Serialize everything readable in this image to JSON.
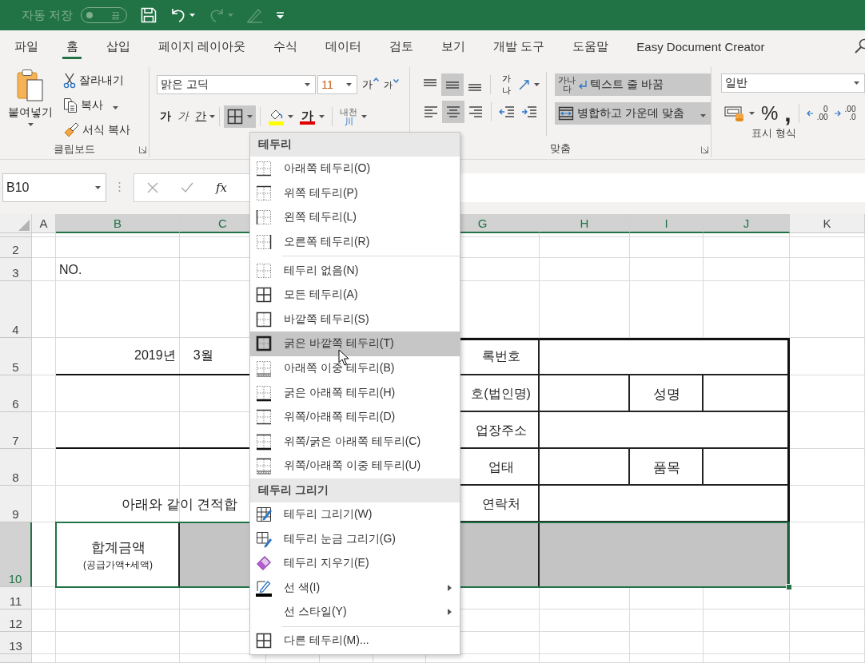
{
  "titlebar": {
    "autosave": "자동 저장",
    "autosave_state": "끔",
    "autosave_on": false
  },
  "tabs": [
    {
      "label": "파일",
      "selected": false
    },
    {
      "label": "홈",
      "selected": true
    },
    {
      "label": "삽입",
      "selected": false
    },
    {
      "label": "페이지 레이아웃",
      "selected": false
    },
    {
      "label": "수식",
      "selected": false
    },
    {
      "label": "데이터",
      "selected": false
    },
    {
      "label": "검토",
      "selected": false
    },
    {
      "label": "보기",
      "selected": false
    },
    {
      "label": "개발 도구",
      "selected": false
    },
    {
      "label": "도움말",
      "selected": false
    },
    {
      "label": "Easy Document Creator",
      "selected": false
    }
  ],
  "clipboard": {
    "paste": "붙여넣기",
    "cut": "잘라내기",
    "copy": "복사",
    "format_painter": "서식 복사",
    "label": "클립보드"
  },
  "font": {
    "name": "맑은 고딕",
    "size": "11",
    "grow": "가",
    "shrink": "가",
    "bold": "가",
    "italic": "가",
    "underline": "간",
    "borders_pressed": true,
    "font_color": "가",
    "phonetic": "내천",
    "phonetic_sub": "川"
  },
  "alignment": {
    "vertical": [
      {
        "selected": false
      },
      {
        "selected": true
      },
      {
        "selected": false
      }
    ],
    "horizontal": [
      {
        "selected": false
      },
      {
        "selected": true
      },
      {
        "selected": false
      }
    ],
    "orientation_icon": "가나",
    "wrap_icon": [
      "가나",
      "다"
    ],
    "wrap_text": "텍스트 줄 바꿈",
    "wrap_selected": true,
    "merge": "병합하고 가운데 맞춤",
    "merge_selected": true,
    "label": "맞춤"
  },
  "number": {
    "format": "일반",
    "percent": "%",
    "comma": ",",
    "decimal_increase": [
      "0",
      ".00"
    ],
    "decimal_decrease": [
      ".00",
      ".0"
    ],
    "label": "표시 형식"
  },
  "formula_bar": {
    "name_box": "B10",
    "fx": "fx"
  },
  "sheet": {
    "columns": [
      {
        "label": "A",
        "selected": false
      },
      {
        "label": "B",
        "selected": true
      },
      {
        "label": "C",
        "selected": true
      },
      {
        "label": "G",
        "selected": true
      },
      {
        "label": "H",
        "selected": true
      },
      {
        "label": "I",
        "selected": true
      },
      {
        "label": "J",
        "selected": true
      },
      {
        "label": "K",
        "selected": false
      }
    ],
    "rows": [
      {
        "label": "2",
        "selected": false
      },
      {
        "label": "3",
        "selected": false
      },
      {
        "label": "4",
        "selected": false
      },
      {
        "label": "5",
        "selected": false
      },
      {
        "label": "6",
        "selected": false
      },
      {
        "label": "7",
        "selected": false
      },
      {
        "label": "8",
        "selected": false
      },
      {
        "label": "9",
        "selected": false
      },
      {
        "label": "10",
        "selected": true
      },
      {
        "label": "11",
        "selected": false
      },
      {
        "label": "12",
        "selected": false
      },
      {
        "label": "13",
        "selected": false
      }
    ],
    "cells": [
      {
        "text": "NO."
      },
      {
        "text": "2019년     3월"
      },
      {
        "text": "아래와 같이 견적합"
      },
      {
        "text": "합계금액",
        "note": "(공급가액+세액)"
      },
      {
        "text": "록번호"
      },
      {
        "text": "호(법인명)"
      },
      {
        "text": "성명"
      },
      {
        "text": "업장주소"
      },
      {
        "text": "업태"
      },
      {
        "text": "품목"
      },
      {
        "text": "연락처"
      }
    ]
  },
  "menu": {
    "items": [
      {
        "kind": "header",
        "label": "테두리"
      },
      {
        "kind": "item",
        "label": "아래쪽 테두리(O)",
        "selected": false,
        "submenu": false
      },
      {
        "kind": "item",
        "label": "위쪽 테두리(P)",
        "selected": false,
        "submenu": false
      },
      {
        "kind": "item",
        "label": "왼쪽 테두리(L)",
        "selected": false,
        "submenu": false
      },
      {
        "kind": "item",
        "label": "오른쪽 테두리(R)",
        "selected": false,
        "submenu": false
      },
      {
        "kind": "separator"
      },
      {
        "kind": "item",
        "label": "테두리 없음(N)",
        "selected": false,
        "submenu": false
      },
      {
        "kind": "item",
        "label": "모든 테두리(A)",
        "selected": false,
        "submenu": false
      },
      {
        "kind": "item",
        "label": "바깥쪽 테두리(S)",
        "selected": false,
        "submenu": false
      },
      {
        "kind": "item",
        "label": "굵은 바깥쪽 테두리(T)",
        "selected": true,
        "submenu": false
      },
      {
        "kind": "item",
        "label": "아래쪽 이중 테두리(B)",
        "selected": false,
        "submenu": false
      },
      {
        "kind": "item",
        "label": "굵은 아래쪽 테두리(H)",
        "selected": false,
        "submenu": false
      },
      {
        "kind": "item",
        "label": "위쪽/아래쪽 테두리(D)",
        "selected": false,
        "submenu": false
      },
      {
        "kind": "item",
        "label": "위쪽/굵은 아래쪽 테두리(C)",
        "selected": false,
        "submenu": false
      },
      {
        "kind": "item",
        "label": "위쪽/아래쪽 이중 테두리(U)",
        "selected": false,
        "submenu": false
      },
      {
        "kind": "header",
        "label": "테두리 그리기"
      },
      {
        "kind": "item",
        "label": "테두리 그리기(W)",
        "selected": false,
        "submenu": false
      },
      {
        "kind": "item",
        "label": "테두리 눈금 그리기(G)",
        "selected": false,
        "submenu": false
      },
      {
        "kind": "item",
        "label": "테두리 지우기(E)",
        "selected": false,
        "submenu": false
      },
      {
        "kind": "item",
        "label": "선 색(I)",
        "selected": false,
        "submenu": true
      },
      {
        "kind": "item",
        "label": "선 스타일(Y)",
        "selected": false,
        "submenu": true
      },
      {
        "kind": "separator"
      },
      {
        "kind": "item",
        "label": "다른 테두리(M)...",
        "selected": false,
        "submenu": false
      }
    ]
  }
}
